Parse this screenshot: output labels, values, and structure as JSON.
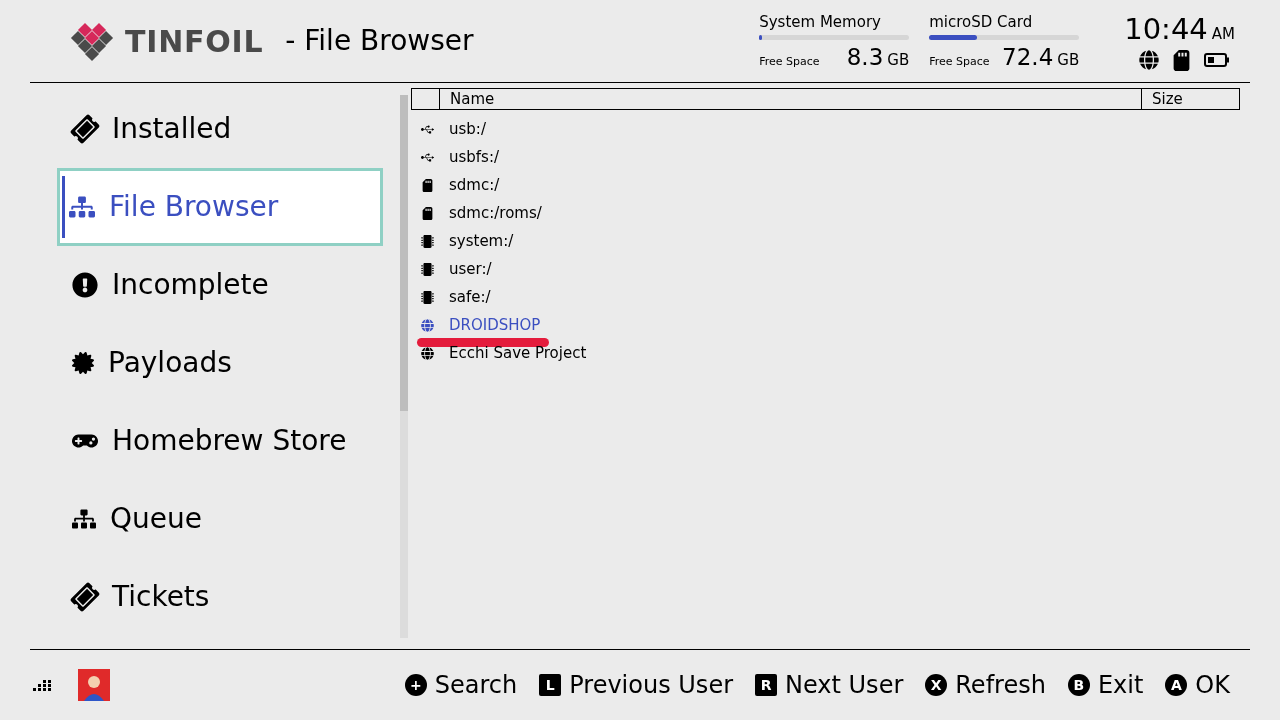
{
  "header": {
    "logo": "TINFOIL",
    "title": "- File Browser"
  },
  "storage": [
    {
      "label": "System Memory",
      "level": 0.02,
      "free_label": "Free Space",
      "amount": "8.3",
      "unit": "GB"
    },
    {
      "label": "microSD Card",
      "level": 0.32,
      "free_label": "Free Space",
      "amount": "72.4",
      "unit": "GB"
    }
  ],
  "clock": {
    "time": "10:44",
    "ampm": "AM"
  },
  "sidebar": {
    "items": [
      {
        "label": "Installed",
        "kind": "ticket",
        "selected": false
      },
      {
        "label": "File Browser",
        "kind": "tree",
        "selected": true
      },
      {
        "label": "Incomplete",
        "kind": "alert",
        "selected": false
      },
      {
        "label": "Payloads",
        "kind": "badge",
        "selected": false
      },
      {
        "label": "Homebrew Store",
        "kind": "gamepad",
        "selected": false
      },
      {
        "label": "Queue",
        "kind": "sitemap",
        "selected": false
      },
      {
        "label": "Tickets",
        "kind": "ticket",
        "selected": false
      }
    ]
  },
  "table": {
    "columns": [
      "Name",
      "Size"
    ],
    "rows": [
      {
        "name": "usb:/",
        "kind": "usb",
        "selected": false,
        "underlined": false
      },
      {
        "name": "usbfs:/",
        "kind": "usb",
        "selected": false,
        "underlined": false
      },
      {
        "name": "sdmc:/",
        "kind": "sd",
        "selected": false,
        "underlined": false
      },
      {
        "name": "sdmc:/roms/",
        "kind": "sd",
        "selected": false,
        "underlined": false
      },
      {
        "name": "system:/",
        "kind": "chip",
        "selected": false,
        "underlined": false
      },
      {
        "name": "user:/",
        "kind": "chip",
        "selected": false,
        "underlined": false
      },
      {
        "name": "safe:/",
        "kind": "chip",
        "selected": false,
        "underlined": false
      },
      {
        "name": "DROIDSHOP",
        "kind": "globe",
        "selected": true,
        "underlined": true
      },
      {
        "name": "Ecchi Save Project",
        "kind": "globe",
        "selected": false,
        "underlined": false
      }
    ]
  },
  "footer": {
    "actions": [
      {
        "key": "+",
        "label": "Search",
        "kind": "circle"
      },
      {
        "key": "L",
        "label": "Previous User",
        "kind": "square"
      },
      {
        "key": "R",
        "label": "Next User",
        "kind": "square"
      },
      {
        "key": "X",
        "label": "Refresh",
        "kind": "circle"
      },
      {
        "key": "B",
        "label": "Exit",
        "kind": "circle"
      },
      {
        "key": "A",
        "label": "OK",
        "kind": "circle"
      }
    ]
  }
}
